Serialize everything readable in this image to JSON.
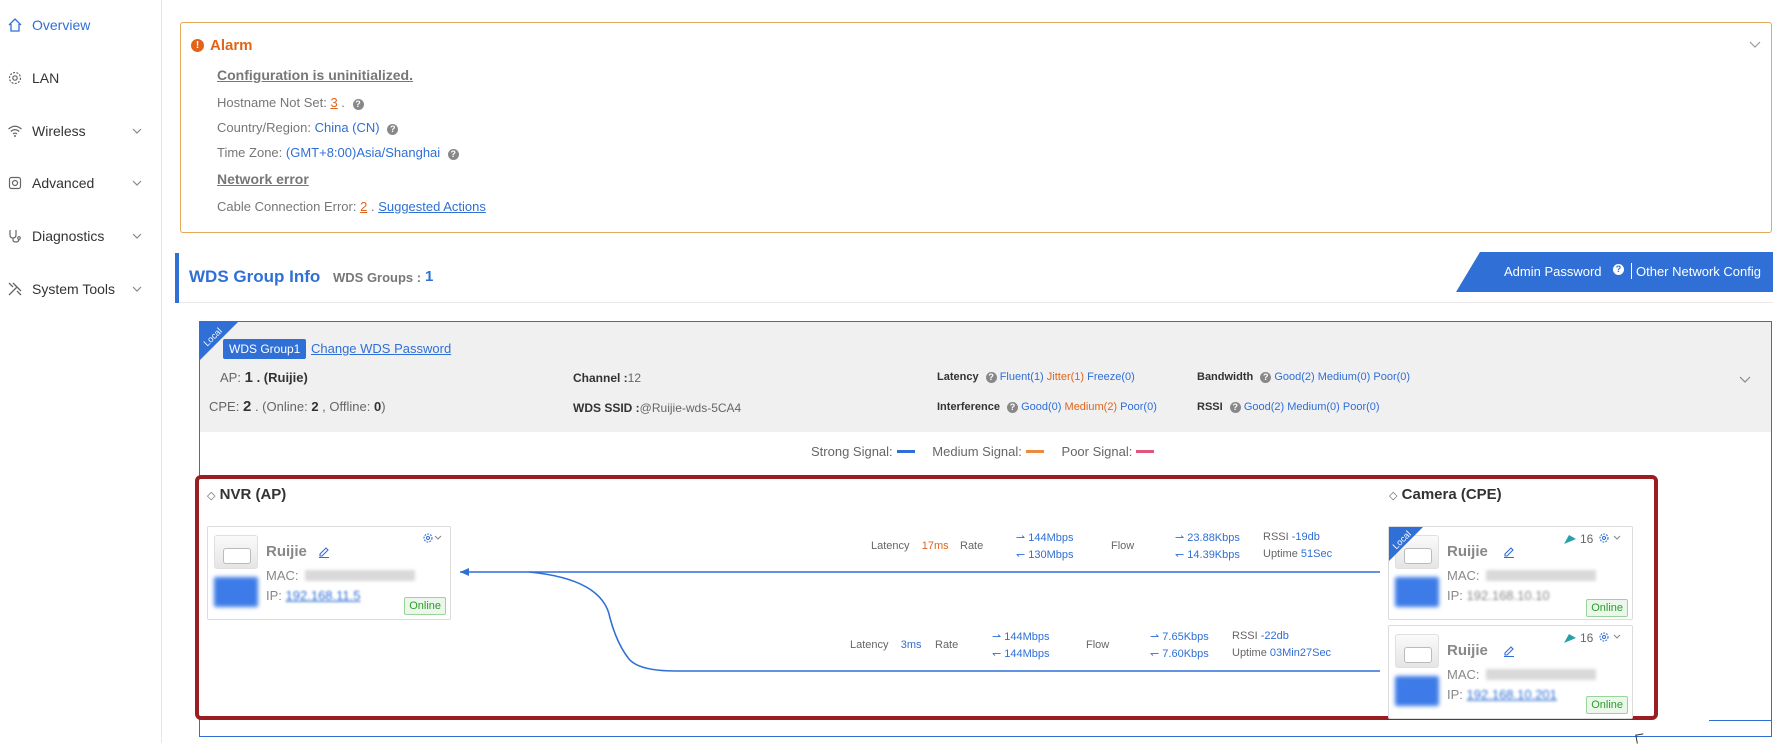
{
  "sidebar": {
    "items": [
      {
        "label": "Overview",
        "icon": "home-icon",
        "active": true,
        "expandable": false
      },
      {
        "label": "LAN",
        "icon": "gear-icon",
        "active": false,
        "expandable": false
      },
      {
        "label": "Wireless",
        "icon": "wifi-icon",
        "active": false,
        "expandable": true
      },
      {
        "label": "Advanced",
        "icon": "cog-icon",
        "active": false,
        "expandable": true
      },
      {
        "label": "Diagnostics",
        "icon": "stethoscope-icon",
        "active": false,
        "expandable": true
      },
      {
        "label": "System Tools",
        "icon": "tools-icon",
        "active": false,
        "expandable": true
      }
    ]
  },
  "alarm": {
    "title": "Alarm",
    "config_heading": "Configuration is uninitialized.",
    "hostname_label": "Hostname Not Set:",
    "hostname_count": "3",
    "country_label": "Country/Region:",
    "country_value": "China (CN)",
    "timezone_label": "Time Zone:",
    "timezone_value": "(GMT+8:00)Asia/Shanghai",
    "network_heading": "Network error",
    "cable_label": "Cable Connection Error:",
    "cable_count": "2",
    "suggested_actions": "Suggested Actions"
  },
  "wds": {
    "title": "WDS Group Info",
    "groups_label": "WDS Groups :",
    "groups_count": "1",
    "admin_password": "Admin Password",
    "other_config": "Other Network Config"
  },
  "group": {
    "local_tag": "Local",
    "name": "WDS Group1",
    "change_password": "Change WDS Password",
    "ap_label": "AP:",
    "ap_count": "1",
    "ap_brand": ". (Ruijie)",
    "cpe_label": "CPE:",
    "cpe_count": "2",
    "cpe_online_label": ". (Online:",
    "cpe_online": "2",
    "cpe_offline_label": ", Offline:",
    "cpe_offline": "0",
    "channel_label": "Channel :",
    "channel": "12",
    "ssid_label": "WDS SSID :",
    "ssid": "@Ruijie-wds-5CA4",
    "latency_label": "Latency",
    "latency_fluent": "Fluent(1)",
    "latency_jitter": "Jitter(1)",
    "latency_freeze": "Freeze(0)",
    "interference_label": "Interference",
    "interference_good": "Good(0)",
    "interference_medium": "Medium(2)",
    "interference_poor": "Poor(0)",
    "bandwidth_label": "Bandwidth",
    "bandwidth_good": "Good(2)",
    "bandwidth_medium": "Medium(0)",
    "bandwidth_poor": "Poor(0)",
    "rssi_label": "RSSI",
    "rssi_good": "Good(2)",
    "rssi_medium": "Medium(0)",
    "rssi_poor": "Poor(0)"
  },
  "legend": {
    "strong": "Strong Signal:",
    "medium": "Medium Signal:",
    "poor": "Poor Signal:",
    "strong_color": "#2f6fd6",
    "medium_color": "#ef8a3c",
    "poor_color": "#e0557a"
  },
  "topology": {
    "ap_heading": "NVR (AP)",
    "cpe_heading": "Camera (CPE)",
    "ap": {
      "name": "Ruijie",
      "mac_label": "MAC:",
      "ip_label": "IP:",
      "ip": "192.168.11.5",
      "status": "Online"
    },
    "cpes": [
      {
        "name": "Ruijie",
        "mac_label": "MAC:",
        "ip_label": "IP:",
        "ip": "192.168.10.10",
        "status": "Online",
        "signal": "16",
        "local": "Local"
      },
      {
        "name": "Ruijie",
        "mac_label": "MAC:",
        "ip_label": "IP:",
        "ip": "192.168.10.201",
        "status": "Online",
        "signal": "16"
      }
    ],
    "links": [
      {
        "latency_label": "Latency",
        "latency": "17ms",
        "rate_label": "Rate",
        "rate_tx": "144Mbps",
        "rate_rx": "130Mbps",
        "flow_label": "Flow",
        "flow_tx": "23.88Kbps",
        "flow_rx": "14.39Kbps",
        "rssi_label": "RSSI",
        "rssi": "-19db",
        "uptime_label": "Uptime",
        "uptime": "51Sec"
      },
      {
        "latency_label": "Latency",
        "latency": "3ms",
        "rate_label": "Rate",
        "rate_tx": "144Mbps",
        "rate_rx": "144Mbps",
        "flow_label": "Flow",
        "flow_tx": "7.65Kbps",
        "flow_rx": "7.60Kbps",
        "rssi_label": "RSSI",
        "rssi": "-22db",
        "uptime_label": "Uptime",
        "uptime": "03Min27Sec"
      }
    ]
  }
}
